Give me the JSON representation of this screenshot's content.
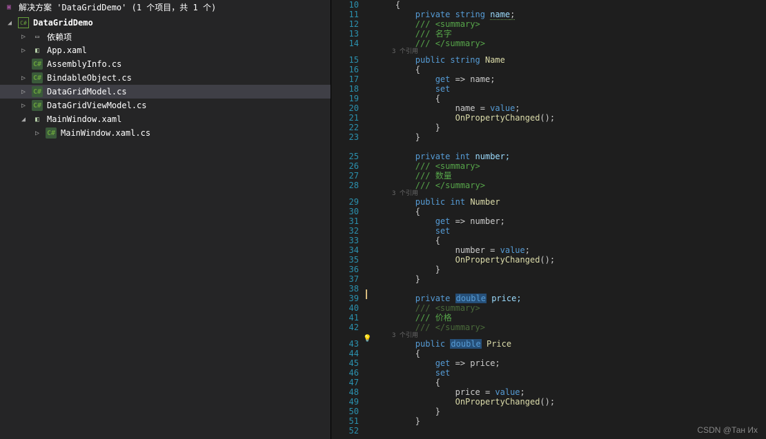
{
  "solution": {
    "title": "解决方案 'DataGridDemo' (1 个项目，共 1 个)"
  },
  "tree": {
    "project": "DataGridDemo",
    "deps": "依赖项",
    "app": "App.xaml",
    "asm": "AssemblyInfo.cs",
    "bind": "BindableObject.cs",
    "model": "DataGridModel.cs",
    "vm": "DataGridViewModel.cs",
    "mw": "MainWindow.xaml",
    "mwcs": "MainWindow.xaml.cs"
  },
  "code": {
    "l10": "{",
    "l11_kw": "private",
    "l11_type": "string",
    "l11_field_a": "name",
    "l11_field_b": ";",
    "l12": "/// <summary>",
    "l13": "/// 名字",
    "l14": "/// </summary>",
    "h1": "3 个引用",
    "l15_mod": "public",
    "l15_type": "string",
    "l15_name": "Name",
    "l16": "{",
    "l17_get": "get",
    "l17_rest": " => name;",
    "l18_set": "set",
    "l19": "{",
    "l20_a": "name = ",
    "l20_b": "value",
    "l20_c": ";",
    "l21_a": "OnPropertyChanged",
    "l21_b": "();",
    "l22": "}",
    "l23": "}",
    "l25_kw": "private",
    "l25_type": "int",
    "l25_field": "number;",
    "l26": "/// <summary>",
    "l27": "/// 数量",
    "l28": "/// </summary>",
    "h2": "3 个引用",
    "l29_mod": "public",
    "l29_type": "int",
    "l29_name": "Number",
    "l30": "{",
    "l31_get": "get",
    "l31_rest": " => number;",
    "l32_set": "set",
    "l33": "{",
    "l34_a": "number = ",
    "l34_b": "value",
    "l34_c": ";",
    "l35_a": "OnPropertyChanged",
    "l35_b": "();",
    "l36": "}",
    "l37": "}",
    "l39_kw": "private",
    "l39_type": "double",
    "l39_field": " price;",
    "l40": "/// <summary>",
    "l41": "/// 价格",
    "l42": "/// </summary>",
    "h3": "3 个引用",
    "l43_mod": "public",
    "l43_type": "double",
    "l43_name": " Price",
    "l44": "{",
    "l45_get": "get",
    "l45_rest": " => price;",
    "l46_set": "set",
    "l47": "{",
    "l48_a": "price = ",
    "l48_b": "value",
    "l48_c": ";",
    "l49_a": "OnPropertyChanged",
    "l49_b": "();",
    "l50": "}",
    "l51": "}"
  },
  "line_numbers": [
    "10",
    "11",
    "12",
    "13",
    "14",
    "15",
    "16",
    "17",
    "18",
    "19",
    "20",
    "21",
    "22",
    "23",
    "",
    "25",
    "26",
    "27",
    "28",
    "29",
    "30",
    "31",
    "32",
    "33",
    "34",
    "35",
    "36",
    "37",
    "38",
    "39",
    "40",
    "41",
    "42",
    "43",
    "44",
    "45",
    "46",
    "47",
    "48",
    "49",
    "50",
    "51",
    "52"
  ],
  "watermark": "CSDN @Тан Их"
}
